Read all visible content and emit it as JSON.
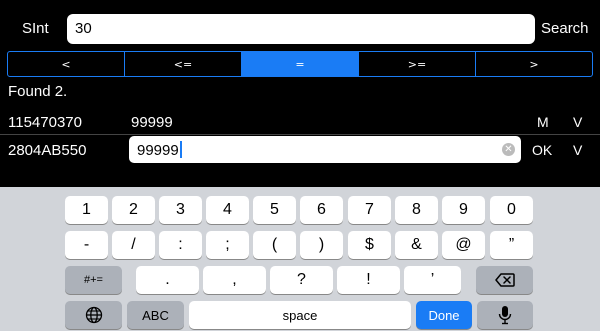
{
  "search": {
    "label": "SInt",
    "value": "30",
    "button": "Search"
  },
  "compare": {
    "options": [
      "<",
      "<=",
      "=",
      ">=",
      ">"
    ],
    "selected": "="
  },
  "results": {
    "status": "Found 2.",
    "rows": [
      {
        "address": "115470370",
        "value": "99999",
        "action1": "M",
        "action2": "V"
      },
      {
        "address": "2804AB550",
        "value": "99999",
        "action1": "OK",
        "action2": "V",
        "editing": true
      }
    ]
  },
  "keyboard": {
    "row1": [
      "1",
      "2",
      "3",
      "4",
      "5",
      "6",
      "7",
      "8",
      "9",
      "0"
    ],
    "row2": [
      "-",
      "/",
      ":",
      ";",
      "(",
      ")",
      "$",
      "&",
      "@",
      "”"
    ],
    "row3": {
      "symbols_key": "#+=",
      "keys": [
        ".",
        ",",
        "?",
        "!",
        "’"
      ],
      "delete_icon": "backspace-icon"
    },
    "row4": {
      "globe_icon": "globe-icon",
      "abc_key": "ABC",
      "space_key": "space",
      "done_key": "Done",
      "mic_icon": "microphone-icon"
    }
  },
  "colors": {
    "accent": "#1a7cf5",
    "background": "#000000",
    "keyboard": "#d1d4d9"
  }
}
